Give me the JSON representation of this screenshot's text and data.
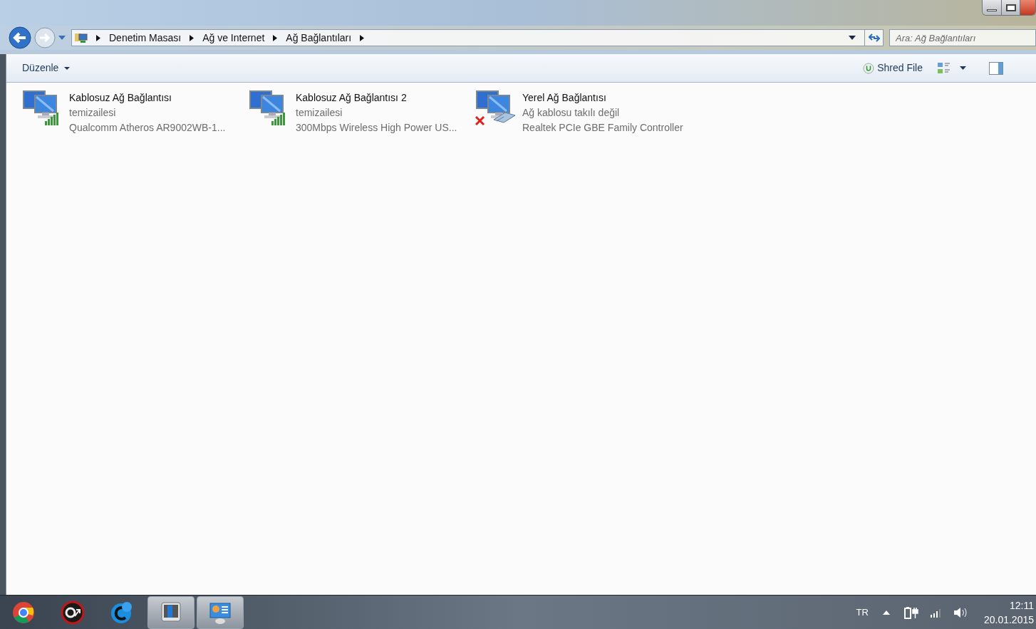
{
  "address_bar": {
    "crumbs": [
      "Denetim Masası",
      "Ağ ve Internet",
      "Ağ Bağlantıları"
    ]
  },
  "search": {
    "placeholder": "Ara: Ağ Bağlantıları"
  },
  "toolbar": {
    "organize": "Düzenle",
    "shred": "Shred File"
  },
  "connections": [
    {
      "kind": "wireless",
      "name": "Kablosuz Ağ Bağlantısı",
      "status": "temizailesi",
      "adapter": "Qualcomm Atheros AR9002WB-1...",
      "disconnected": false
    },
    {
      "kind": "wireless",
      "name": "Kablosuz Ağ Bağlantısı 2",
      "status": "temizailesi",
      "adapter": "300Mbps Wireless High Power US...",
      "disconnected": false
    },
    {
      "kind": "wired",
      "name": "Yerel Ağ Bağlantısı",
      "status": "Ağ kablosu takılı değil",
      "adapter": "Realtek PCIe GBE Family Controller",
      "disconnected": true
    }
  ],
  "taskbar": {
    "apps": [
      {
        "kind": "browser",
        "running": false
      },
      {
        "kind": "gear",
        "running": false
      },
      {
        "kind": "chat",
        "running": false
      },
      {
        "kind": "monitor",
        "running": true
      },
      {
        "kind": "panel",
        "running": true
      }
    ],
    "language": "TR",
    "time": "12:11",
    "date": "20.01.2015"
  }
}
